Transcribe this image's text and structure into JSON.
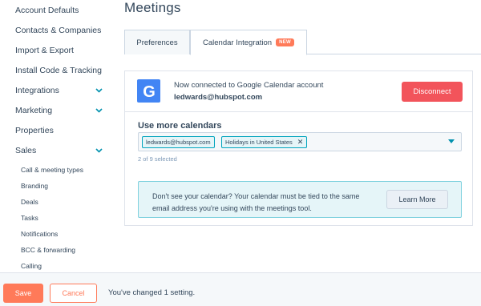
{
  "sidebar": {
    "items": [
      {
        "label": "Account Defaults",
        "expandable": false
      },
      {
        "label": "Contacts & Companies",
        "expandable": false
      },
      {
        "label": "Import & Export",
        "expandable": false
      },
      {
        "label": "Install Code & Tracking",
        "expandable": false
      },
      {
        "label": "Integrations",
        "expandable": true
      },
      {
        "label": "Marketing",
        "expandable": true
      },
      {
        "label": "Properties",
        "expandable": false
      },
      {
        "label": "Sales",
        "expandable": true
      }
    ],
    "sales_subitems": [
      {
        "label": "Call & meeting types"
      },
      {
        "label": "Branding"
      },
      {
        "label": "Deals"
      },
      {
        "label": "Tasks"
      },
      {
        "label": "Notifications"
      },
      {
        "label": "BCC & forwarding"
      },
      {
        "label": "Calling"
      }
    ]
  },
  "page": {
    "title": "Meetings"
  },
  "tabs": [
    {
      "label": "Preferences",
      "active": false
    },
    {
      "label": "Calendar Integration",
      "active": true,
      "badge": "NEW"
    }
  ],
  "connection": {
    "logo_letter": "G",
    "status_text": "Now connected to Google Calendar account",
    "account_email": "ledwards@hubspot.com",
    "disconnect_label": "Disconnect"
  },
  "calendars": {
    "label": "Use more calendars",
    "selected": [
      {
        "label": "ledwards@hubspot.com",
        "removable": false
      },
      {
        "label": "Holidays in United States",
        "removable": true
      }
    ],
    "count_text": "2 of 9 selected"
  },
  "info": {
    "text": "Don't see your calendar? Your calendar must be tied to the same email address you're using with the meetings tool.",
    "learn_more_label": "Learn More"
  },
  "footer": {
    "save_label": "Save",
    "cancel_label": "Cancel",
    "changed_text": "You've changed 1 setting."
  },
  "colors": {
    "accent_orange": "#ff7a59",
    "disconnect_red": "#f2545b",
    "teal": "#00a4bd",
    "google_blue": "#4285f4",
    "text": "#33475b"
  }
}
